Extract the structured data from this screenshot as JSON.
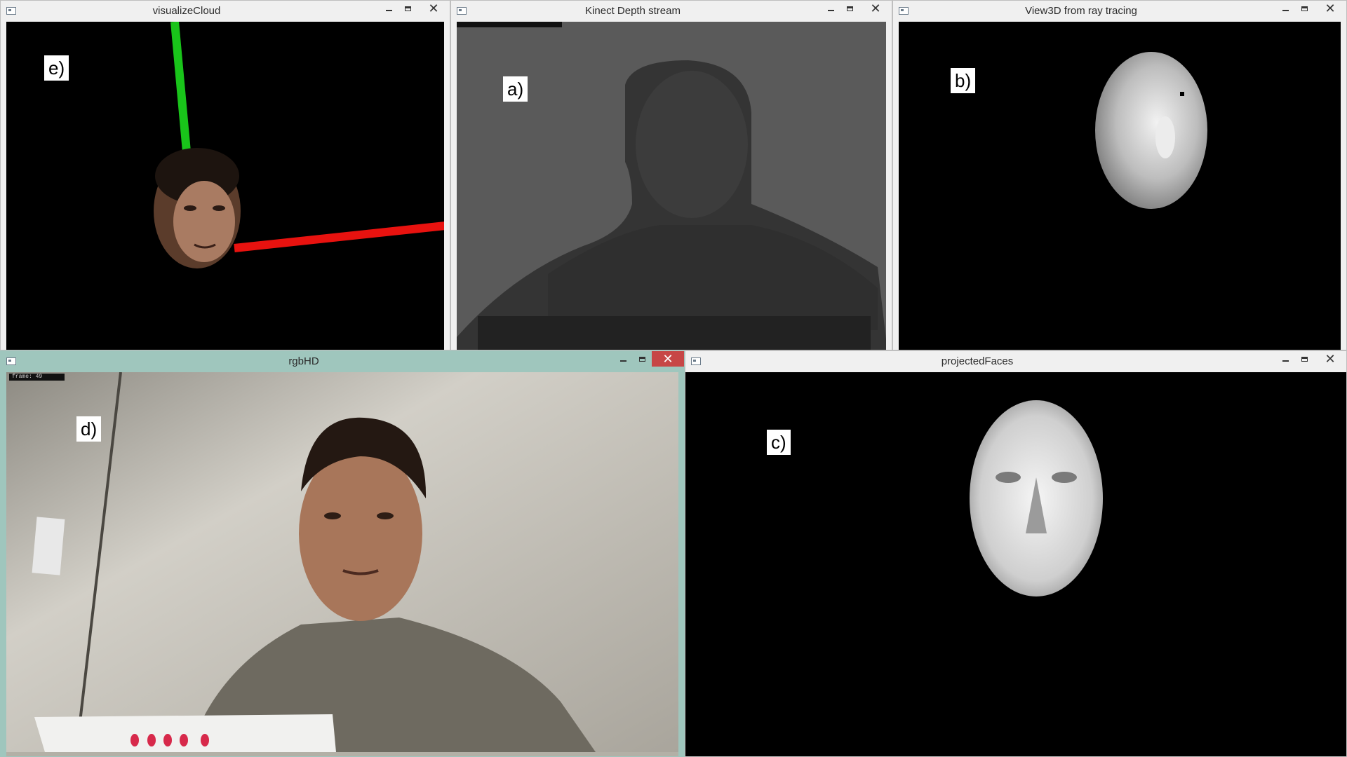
{
  "windows": {
    "visualize_cloud": {
      "title": "visualizeCloud",
      "label": "e)"
    },
    "kinect_depth": {
      "title": "Kinect Depth stream",
      "label": "a)"
    },
    "view3d": {
      "title": "View3D from ray tracing",
      "label": "b)"
    },
    "rgbhd": {
      "title": "rgbHD",
      "label": "d)",
      "frame_counter": "frame: 49"
    },
    "projected_faces": {
      "title": "projectedFaces",
      "label": "c)"
    }
  },
  "window_controls": {
    "minimize": "–",
    "maximize": "□",
    "close": "✕"
  },
  "colors": {
    "axis_green": "#19c41a",
    "axis_red": "#e8120f",
    "active_frame": "#9fc6bd",
    "close_active": "#c74646",
    "depth_background": "#5a5a5a"
  },
  "icons": [
    "window-menu-icon",
    "minimize-icon",
    "maximize-icon",
    "close-icon"
  ]
}
